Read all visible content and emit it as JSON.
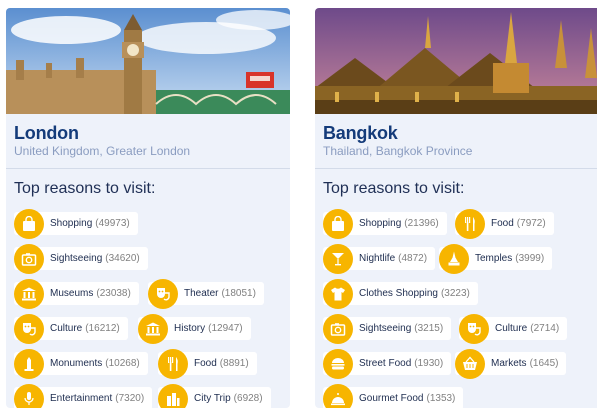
{
  "colors": {
    "accent": "#f7b500",
    "city": "#143b7a",
    "region": "#8a9cc0",
    "card": "#eef2fa"
  },
  "london": {
    "city": "London",
    "region": "United Kingdom, Greater London",
    "reasons_title": "Top reasons to visit:",
    "reasons": [
      {
        "label": "Shopping",
        "count": "(49973)",
        "icon": "shopping-bag-icon"
      },
      {
        "label": "Sightseeing",
        "count": "(34620)",
        "icon": "camera-icon"
      },
      {
        "label": "Museums",
        "count": "(23038)",
        "icon": "museum-icon"
      },
      {
        "label": "Theater",
        "count": "(18051)",
        "icon": "theater-masks-icon"
      },
      {
        "label": "Culture",
        "count": "(16212)",
        "icon": "culture-masks-icon"
      },
      {
        "label": "History",
        "count": "(12947)",
        "icon": "history-building-icon"
      },
      {
        "label": "Monuments",
        "count": "(10268)",
        "icon": "monument-icon"
      },
      {
        "label": "Food",
        "count": "(8891)",
        "icon": "fork-knife-icon"
      },
      {
        "label": "Entertainment",
        "count": "(7320)",
        "icon": "microphone-icon"
      },
      {
        "label": "City Trip",
        "count": "(6928)",
        "icon": "city-buildings-icon"
      }
    ]
  },
  "bangkok": {
    "city": "Bangkok",
    "region": "Thailand, Bangkok Province",
    "reasons_title": "Top reasons to visit:",
    "reasons": [
      {
        "label": "Shopping",
        "count": "(21396)",
        "icon": "shopping-bag-icon"
      },
      {
        "label": "Food",
        "count": "(7972)",
        "icon": "fork-knife-icon"
      },
      {
        "label": "Nightlife",
        "count": "(4872)",
        "icon": "cocktail-icon"
      },
      {
        "label": "Temples",
        "count": "(3999)",
        "icon": "temple-icon"
      },
      {
        "label": "Clothes Shopping",
        "count": "(3223)",
        "icon": "tshirt-icon"
      },
      {
        "label": "Sightseeing",
        "count": "(3215)",
        "icon": "camera-icon"
      },
      {
        "label": "Culture",
        "count": "(2714)",
        "icon": "culture-masks-icon"
      },
      {
        "label": "Street Food",
        "count": "(1930)",
        "icon": "burger-icon"
      },
      {
        "label": "Markets",
        "count": "(1645)",
        "icon": "basket-icon"
      },
      {
        "label": "Gourmet Food",
        "count": "(1353)",
        "icon": "cloche-icon"
      }
    ]
  }
}
